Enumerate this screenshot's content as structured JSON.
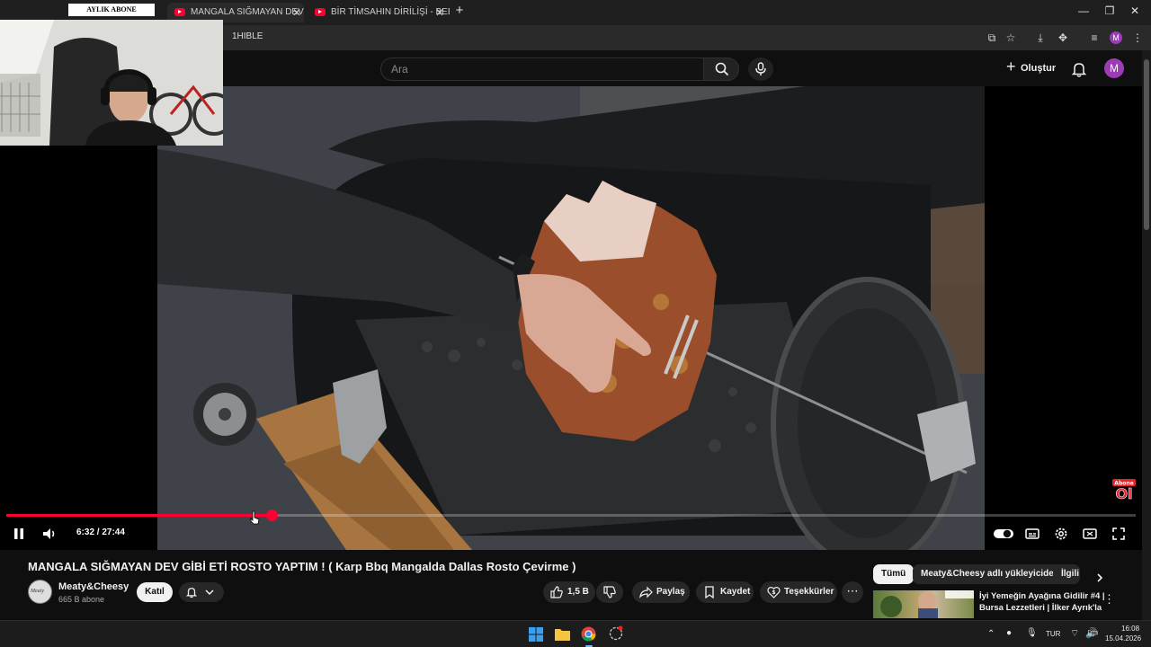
{
  "browser": {
    "tabs": [
      {
        "label": "MANGALA SIĞMAYAN DEV",
        "active": true
      },
      {
        "label": "BİR TİMSAHIN DİRİLİŞİ - BEBEK",
        "active": false
      }
    ],
    "url": "1HIBLE"
  },
  "header": {
    "search_placeholder": "Ara",
    "create_label": "Oluştur",
    "avatar_letter": "M"
  },
  "webcam": {
    "banner": "AYLIK ABONE"
  },
  "player": {
    "current_time": "6:32",
    "duration": "27:44",
    "time_display": "6:32 / 27:44",
    "progress_fraction": 0.2355,
    "buffered_fraction": 0.2355,
    "badge_text": "Abone Ol"
  },
  "video": {
    "title": "MANGALA SIĞMAYAN DEV GİBİ ETİ ROSTO YAPTIM ! ( Karp Bbq Mangalda Dallas Rosto Çevirme )",
    "channel_name": "Meaty&Cheesy",
    "channel_avatar_text": "Meaty",
    "subscribers": "665 B abone",
    "join_label": "Katıl",
    "like_count": "1,5 B",
    "share_label": "Paylaş",
    "save_label": "Kaydet",
    "thanks_label": "Teşekkürler"
  },
  "sidebar": {
    "chips": [
      "Tümü",
      "Meaty&Cheesy adlı yükleyiciden",
      "İlgili"
    ],
    "recommendation_title": "İyi Yemeğin Ayağına Gidilir #4 | Bursa Lezzetleri | İlker Ayrık'la ..."
  },
  "taskbar": {
    "language": "TUR",
    "time": "16:08",
    "date": "15.04.2026"
  },
  "colors": {
    "accent_red": "#ff0033",
    "background": "#0f0f0f",
    "avatar_purple": "#9b3bb5"
  }
}
